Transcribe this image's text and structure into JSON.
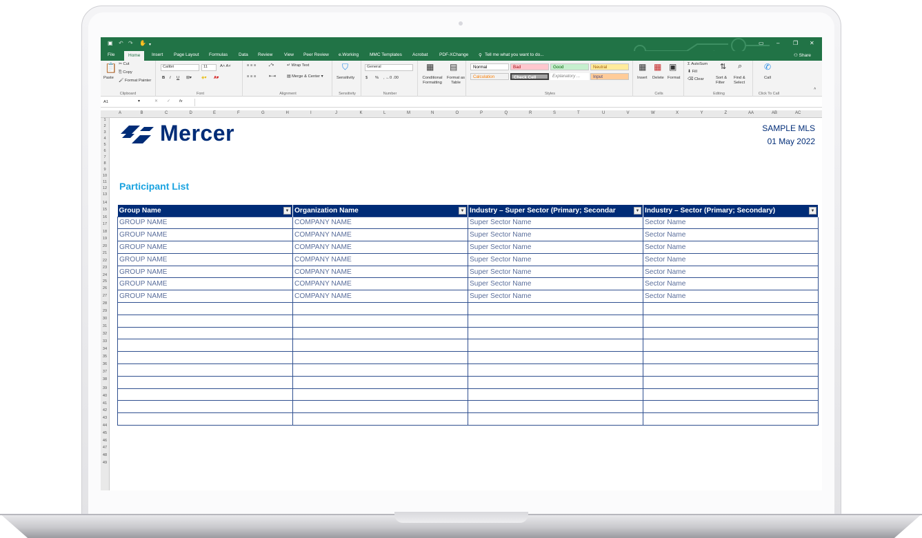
{
  "window": {
    "share_label": "Share"
  },
  "ribbon_tabs": [
    "File",
    "Home",
    "Insert",
    "Page Layout",
    "Formulas",
    "Data",
    "Review",
    "View",
    "Peer Review",
    "e.Working",
    "MMC Templates",
    "Acrobat",
    "PDF-XChange"
  ],
  "tell_me": "Tell me what you want to do...",
  "clipboard": {
    "paste": "Paste",
    "cut": "Cut",
    "copy": "Copy",
    "format_painter": "Format Painter",
    "label": "Clipboard"
  },
  "font": {
    "name": "Calibri",
    "size": "11",
    "label": "Font",
    "bold": "B",
    "italic": "I",
    "underline": "U"
  },
  "alignment": {
    "wrap": "Wrap Text",
    "merge": "Merge & Center",
    "label": "Alignment"
  },
  "sensitivity": {
    "button": "Sensitivity",
    "label": "Sensitivity"
  },
  "number": {
    "format": "General",
    "label": "Number",
    "currency": "$",
    "percent": "%"
  },
  "conditional": {
    "label": "Conditional Formatting"
  },
  "format_table": {
    "label": "Format as Table"
  },
  "styles": {
    "label": "Styles",
    "items": [
      {
        "name": "Normal",
        "bg": "#ffffff",
        "color": "#000000"
      },
      {
        "name": "Bad",
        "bg": "#ffc7ce",
        "color": "#9c0006"
      },
      {
        "name": "Good",
        "bg": "#c6efce",
        "color": "#006100"
      },
      {
        "name": "Neutral",
        "bg": "#ffeb9c",
        "color": "#9c5700"
      },
      {
        "name": "Calculation",
        "bg": "#f2f2f2",
        "color": "#fa7d00"
      },
      {
        "name": "Check Cell",
        "bg": "#a5a5a5",
        "color": "#ffffff"
      },
      {
        "name": "Explanatory ...",
        "bg": "#ffffff",
        "color": "#7f7f7f"
      },
      {
        "name": "Input",
        "bg": "#ffcc99",
        "color": "#3f3f76"
      }
    ]
  },
  "cells": {
    "insert": "Insert",
    "delete": "Delete",
    "format": "Format",
    "label": "Cells"
  },
  "editing": {
    "autosum": "AutoSum",
    "fill": "Fill",
    "clear": "Clear",
    "sort": "Sort & Filter",
    "find": "Find & Select",
    "label": "Editing"
  },
  "call": {
    "button": "Call",
    "label": "Click To Call"
  },
  "formula_bar": {
    "name_box": "A1",
    "fx": "fx",
    "value": ""
  },
  "columns": [
    "A",
    "B",
    "C",
    "D",
    "E",
    "F",
    "G",
    "H",
    "I",
    "J",
    "K",
    "L",
    "M",
    "N",
    "O",
    "P",
    "Q",
    "R",
    "S",
    "T",
    "U",
    "V",
    "W",
    "X",
    "Y",
    "Z",
    "AA",
    "AB",
    "AC"
  ],
  "rows": [
    "1",
    "2",
    "3",
    "4",
    "5",
    "6",
    "7",
    "8",
    "9",
    "10",
    "11",
    "12",
    "13",
    "14",
    "15",
    "16",
    "17",
    "18",
    "19",
    "20",
    "21",
    "22",
    "23",
    "24",
    "25",
    "26",
    "27",
    "28",
    "29",
    "30",
    "31",
    "32",
    "33",
    "34",
    "35",
    "36",
    "37",
    "38",
    "39",
    "40",
    "41",
    "42",
    "43",
    "44",
    "45",
    "46",
    "47",
    "48",
    "49"
  ],
  "logo": {
    "text": "Mercer",
    "color": "#002c77"
  },
  "header_right": {
    "line1": "SAMPLE MLS",
    "line2": "01 May 2022"
  },
  "page_title": "Participant List",
  "table": {
    "headers": [
      "Group Name",
      "Organization Name",
      "Industry – Super Sector (Primary; Secondar",
      "Industry – Sector (Primary; Secondary)"
    ],
    "rows": [
      [
        "GROUP NAME",
        "COMPANY NAME",
        "Super Sector Name",
        "Sector Name"
      ],
      [
        "GROUP NAME",
        "COMPANY NAME",
        "Super Sector Name",
        "Sector Name"
      ],
      [
        "GROUP NAME",
        "COMPANY NAME",
        "Super Sector Name",
        "Sector Name"
      ],
      [
        "GROUP NAME",
        "COMPANY NAME",
        "Super Sector Name",
        "Sector Name"
      ],
      [
        "GROUP NAME",
        "COMPANY NAME",
        "Super Sector Name",
        "Sector Name"
      ],
      [
        "GROUP NAME",
        "COMPANY NAME",
        "Super Sector Name",
        "Sector Name"
      ],
      [
        "GROUP NAME",
        "COMPANY NAME",
        "Super Sector Name",
        "Sector Name"
      ]
    ],
    "empty_rows": 10
  }
}
